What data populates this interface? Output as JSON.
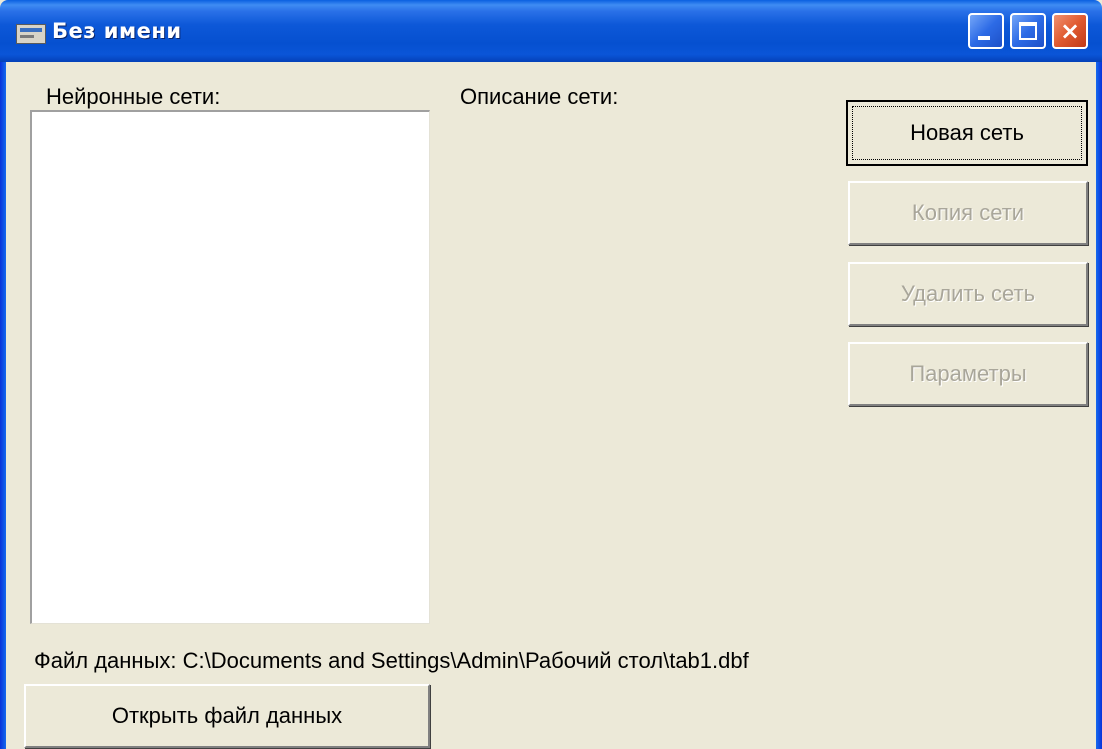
{
  "window": {
    "title": "Без имени",
    "icon": "app-window-icon",
    "controls": {
      "minimize": "minimize-icon",
      "maximize": "maximize-icon",
      "close": "×"
    },
    "colors": {
      "titlebar": "#0A55D8",
      "background": "#ECE9D8",
      "close_button": "#E05A30"
    }
  },
  "networks": {
    "label": "Нейронные сети:",
    "items": []
  },
  "description": {
    "label": "Описание сети:"
  },
  "buttons": {
    "new_network": "Новая сеть",
    "copy_network": "Копия сети",
    "delete_network": "Удалить сеть",
    "parameters": "Параметры",
    "open_data_file": "Открыть файл данных"
  },
  "data_file": {
    "label": "Файл данных: C:\\Documents and Settings\\Admin\\Рабочий стол\\tab1.dbf"
  }
}
